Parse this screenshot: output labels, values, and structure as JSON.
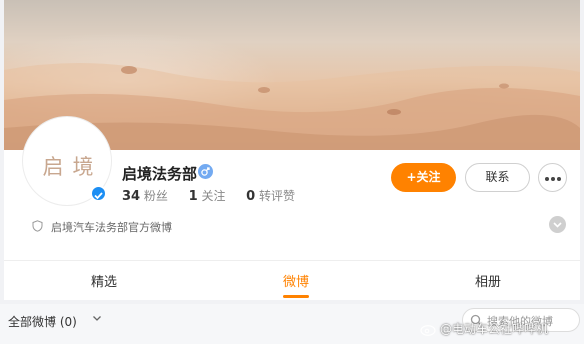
{
  "profile": {
    "avatar_text": "启境",
    "name": "启境法务部",
    "stats": {
      "fans_count": "34",
      "fans_label": "粉丝",
      "following_count": "1",
      "following_label": "关注",
      "likes_count": "0",
      "likes_label": "转评赞"
    },
    "description": "启境汽车法务部官方微博"
  },
  "actions": {
    "follow_label": "+关注",
    "contact_label": "联系"
  },
  "tabs": [
    {
      "label": "精选"
    },
    {
      "label": "微博"
    },
    {
      "label": "相册"
    }
  ],
  "active_tab": "微博",
  "feed_filter": {
    "label": "全部微博 (0)",
    "search_placeholder": "搜索他的微博"
  },
  "watermark": "@电动车公社哔哔机",
  "colors": {
    "accent": "#ff8200",
    "verified": "#1c8ef3",
    "gender": "#73aaf1"
  },
  "icons": [
    "verified-icon",
    "male-gender-icon",
    "more-dots-icon",
    "shield-icon",
    "expand-chevron-icon",
    "chevron-down-icon",
    "search-icon",
    "weibo-logo-icon"
  ]
}
